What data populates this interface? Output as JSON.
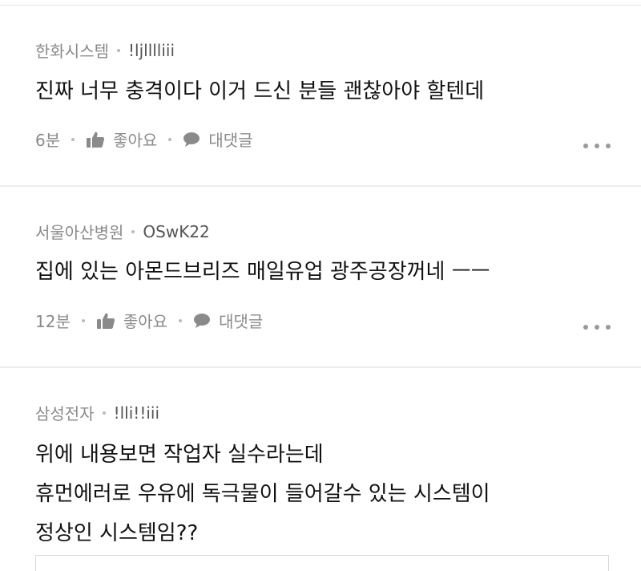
{
  "comments": [
    {
      "company": "한화시스템",
      "user": "!ljlllliii",
      "lines": [
        "진짜 너무 충격이다 이거 드신 분들  괜찮아야 할텐데"
      ],
      "time": "6분",
      "like_label": "좋아요",
      "reply_label": "대댓글"
    },
    {
      "company": "서울아산병원",
      "user": "OSwK22",
      "lines": [
        "집에 있는 아몬드브리즈 매일유업 광주공장꺼네 ㅡㅡ"
      ],
      "time": "12분",
      "like_label": "좋아요",
      "reply_label": "대댓글"
    },
    {
      "company": "삼성전자",
      "user": "!lli!!iii",
      "lines": [
        "위에 내용보면 작업자 실수라는데",
        "휴먼에러로 우유에 독극물이 들어갈수 있는 시스템이",
        "정상인 시스템임??"
      ]
    }
  ],
  "icons": {
    "like": "thumbs-up-icon",
    "reply": "speech-bubble-icon",
    "more": "more-dots-icon"
  },
  "colors": {
    "text": "#111111",
    "meta": "#8a8a8a",
    "divider": "#ececec"
  }
}
